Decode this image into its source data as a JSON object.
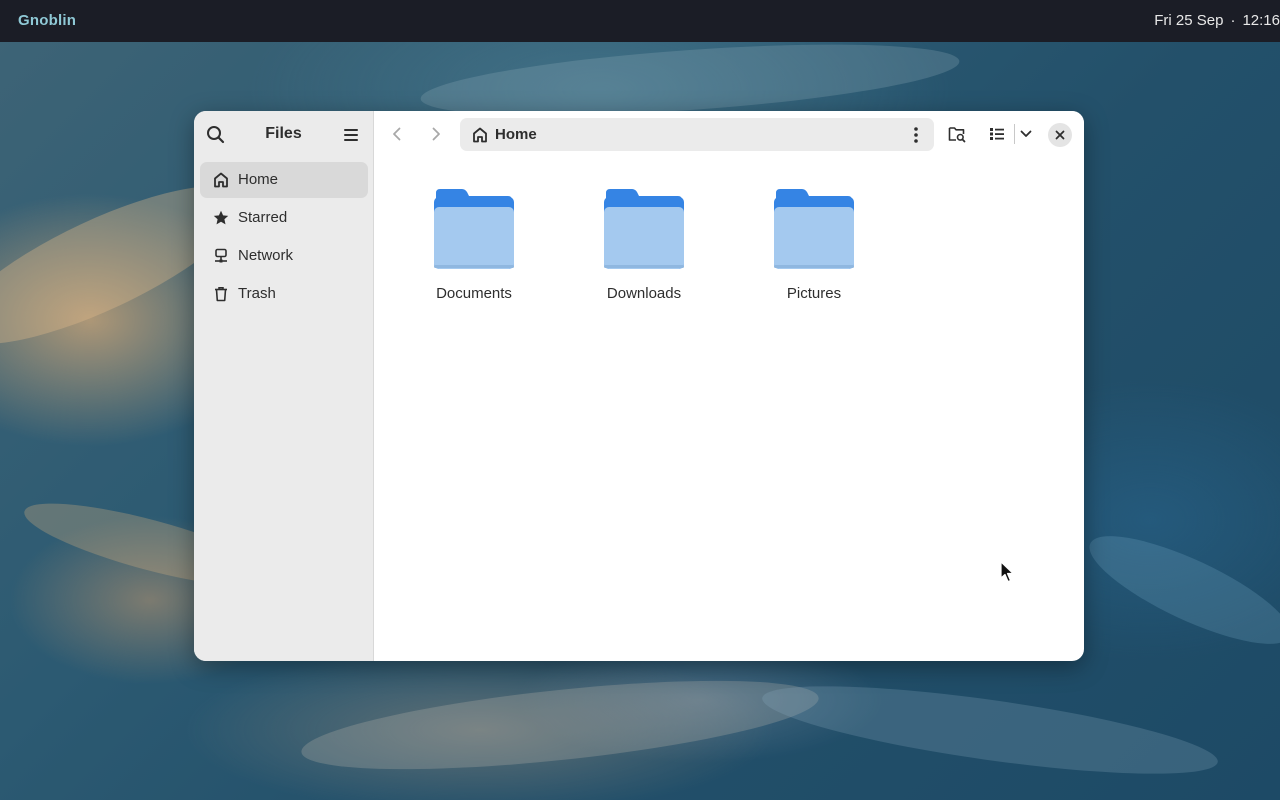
{
  "topbar": {
    "activities_label": "Gnoblin",
    "date": "Fri 25 Sep",
    "separator": "·",
    "time": "12:16"
  },
  "window": {
    "sidebar": {
      "title": "Files",
      "items": [
        {
          "label": "Home",
          "icon": "home-icon",
          "active": true
        },
        {
          "label": "Starred",
          "icon": "star-icon",
          "active": false
        },
        {
          "label": "Network",
          "icon": "network-icon",
          "active": false
        },
        {
          "label": "Trash",
          "icon": "trash-icon",
          "active": false
        }
      ]
    },
    "pathbar": {
      "location": "Home",
      "icon": "home-icon"
    },
    "files": [
      {
        "name": "Documents",
        "type": "folder"
      },
      {
        "name": "Downloads",
        "type": "folder"
      },
      {
        "name": "Pictures",
        "type": "folder"
      }
    ]
  },
  "colors": {
    "topbar": "#1b1d26",
    "activities": "#8fc9d6",
    "sidebar": "#ebebeb",
    "folder_back": "#3584e4",
    "folder_front": "#a4c9ef"
  }
}
